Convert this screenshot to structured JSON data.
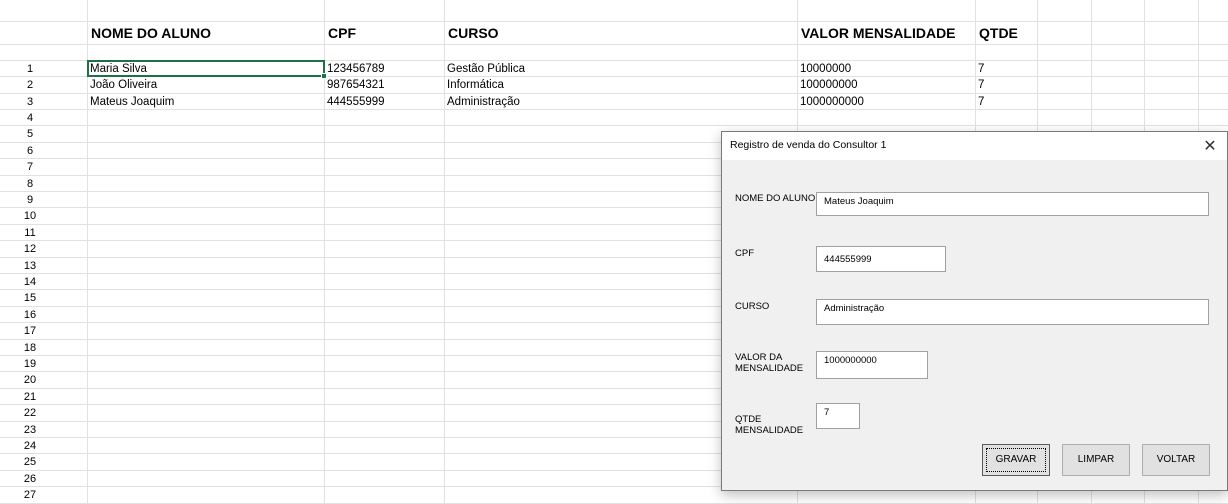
{
  "sheet": {
    "headers": [
      "NOME DO ALUNO",
      "CPF",
      "CURSO",
      "VALOR MENSALIDADE",
      "QTDE"
    ],
    "row_numbers": [
      "1",
      "2",
      "3",
      "4",
      "5",
      "6",
      "7",
      "8",
      "9",
      "10",
      "11",
      "12",
      "13",
      "14",
      "15",
      "16",
      "17",
      "18",
      "19",
      "20",
      "21",
      "22",
      "23",
      "24",
      "25",
      "26",
      "27"
    ],
    "rows": [
      [
        "Maria Silva",
        "123456789",
        "Gestão Pública",
        "10000000",
        "7"
      ],
      [
        "João Oliveira",
        "987654321",
        "Informática",
        "100000000",
        "7"
      ],
      [
        "Mateus Joaquim",
        "444555999",
        "Administração",
        "1000000000",
        "7"
      ]
    ],
    "selection_color": "#1e7145"
  },
  "dialog": {
    "title": "Registro de venda do Consultor 1",
    "close_icon": "close-icon",
    "fields": {
      "nome_label": "NOME DO ALUNO",
      "nome_value": "Mateus Joaquim",
      "cpf_label": "CPF",
      "cpf_value": "444555999",
      "curso_label": "CURSO",
      "curso_value": "Administração",
      "valor_label_1": "VALOR DA",
      "valor_label_2": "MENSALIDADE",
      "valor_value": "1000000000",
      "qtde_label_1": "QTDE",
      "qtde_label_2": "MENSALIDADE",
      "qtde_value": "7"
    },
    "buttons": {
      "gravar": "GRAVAR",
      "limpar": "LIMPAR",
      "voltar": "VOLTAR"
    }
  }
}
